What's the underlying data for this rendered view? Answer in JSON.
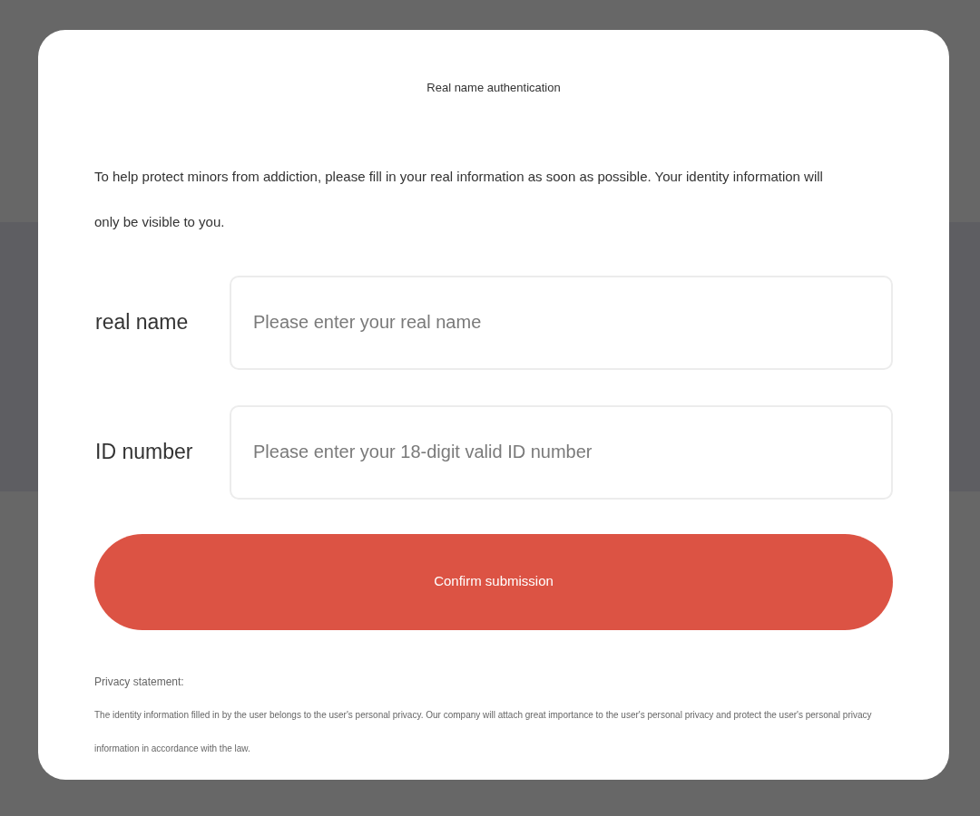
{
  "dialog": {
    "title": "Real name authentication",
    "intro": "To help protect minors from addiction, please fill in your real information as soon as possible. Your identity information will only be visible to you.",
    "fields": [
      {
        "label": "real name",
        "placeholder": "Please enter your real name"
      },
      {
        "label": "ID number",
        "placeholder": "Please enter your 18-digit valid ID number"
      }
    ],
    "submit_button": "Confirm submission",
    "privacy": {
      "heading": "Privacy statement:",
      "text": "The identity information filled in by the user belongs to the user's personal privacy. Our company will attach great importance to the user's personal privacy and protect the user's personal privacy information in accordance with the law."
    }
  }
}
